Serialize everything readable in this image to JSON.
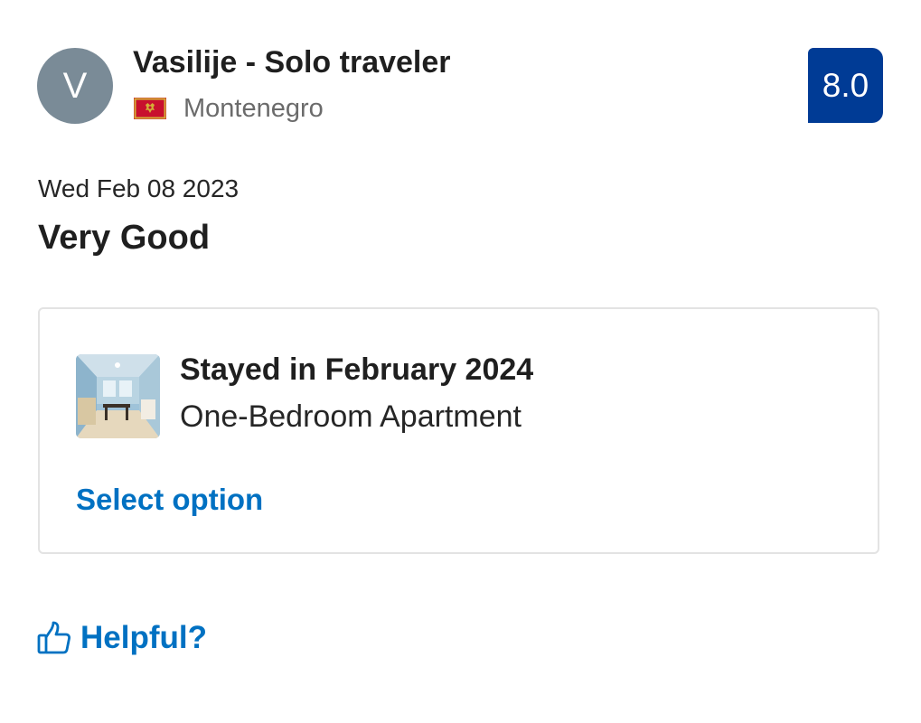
{
  "reviewer": {
    "initial": "V",
    "name": "Vasilije - Solo traveler",
    "country": "Montenegro",
    "flag_icon": "montenegro-flag-icon"
  },
  "score": {
    "value": "8.0",
    "color": "#003b95"
  },
  "review": {
    "date": "Wed Feb 08 2023",
    "title": "Very Good"
  },
  "stay": {
    "title": "Stayed in February 2024",
    "room_type": "One-Bedroom Apartment",
    "select_label": "Select option",
    "thumbnail_icon": "apartment-photo"
  },
  "helpful": {
    "label": "Helpful?",
    "icon": "thumbs-up-icon"
  },
  "colors": {
    "link": "#0071c2",
    "avatar_bg": "#7a8b97",
    "text": "#262626",
    "muted": "#6b6b6b"
  }
}
